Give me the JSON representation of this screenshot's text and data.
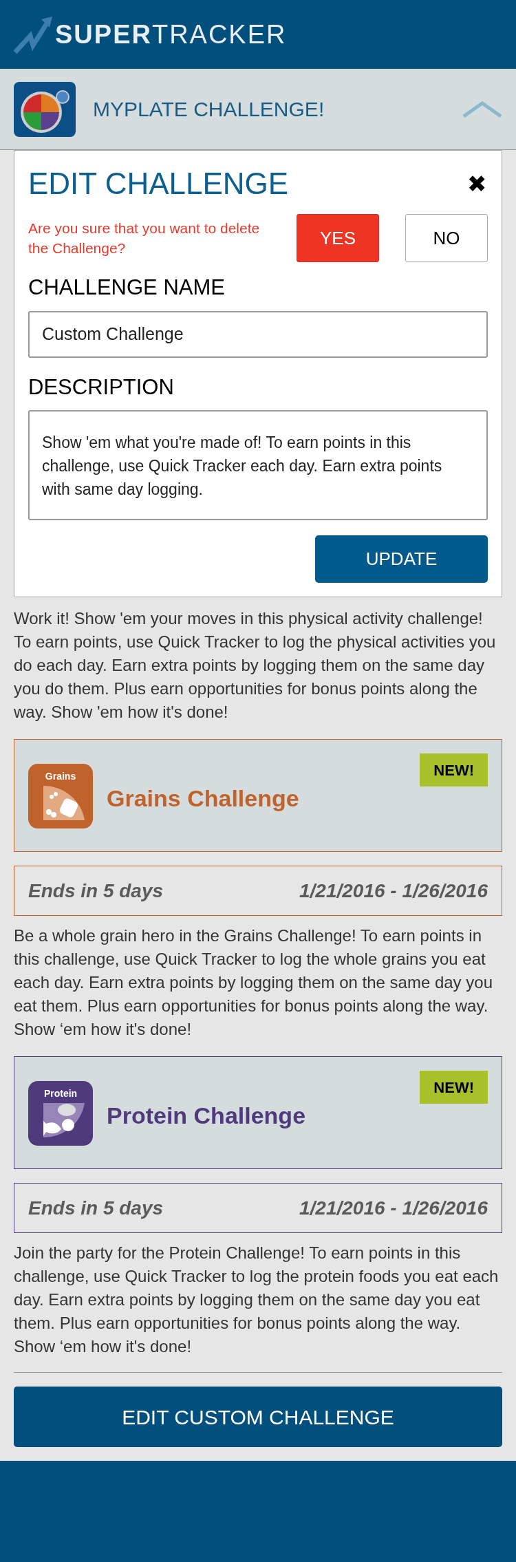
{
  "header": {
    "logo_bold": "SUPER",
    "logo_light": "TRACKER"
  },
  "myplate_bar": {
    "title": "MYPLATE CHALLENGE!",
    "expanded": true
  },
  "dialog": {
    "title": "EDIT CHALLENGE",
    "close": "✖",
    "warning": "Are you sure that you want to delete the Challenge?",
    "yes_button": "YES",
    "no_button": "NO",
    "name_label": "CHALLENGE NAME",
    "name_value": "Custom Challenge",
    "description_label": "DESCRIPTION",
    "description_value": "Show 'em what you're made of! To earn points in this challenge, use Quick Tracker each day. Earn extra points with same day logging.",
    "update_button": "UPDATE"
  },
  "activity_description": "Work it! Show 'em your moves in this physical activity challenge! To earn points, use Quick Tracker to log the physical activities you do each day. Earn extra points by logging them on the same day you do them. Plus earn opportunities for bonus points along the way. Show 'em how it's done!",
  "challenges": [
    {
      "kind": "grains",
      "icon_label": "Grains",
      "title": "Grains Challenge",
      "color": "#c0622b",
      "badge": "NEW!",
      "ends": "Ends in 5 days",
      "dates": "1/21/2016 - 1/26/2016",
      "description": "Be a whole grain hero in the Grains Challenge! To earn points in this challenge, use Quick Tracker to log the whole grains you eat each day. Earn extra points by logging them on the same day you eat them. Plus earn opportunities for bonus points along the way. Show ‘em how it's done!"
    },
    {
      "kind": "protein",
      "icon_label": "Protein",
      "title": "Protein Challenge",
      "color": "#4f3b7c",
      "badge": "NEW!",
      "ends": "Ends in 5 days",
      "dates": "1/21/2016 - 1/26/2016",
      "description": "Join the party for the Protein Challenge! To earn points in this challenge, use Quick Tracker to log the protein foods you eat each day. Earn extra points by logging them on the same day you eat them. Plus earn opportunities for bonus points along the way. Show ‘em how it's done!"
    }
  ],
  "edit_button": "EDIT CUSTOM CHALLENGE"
}
